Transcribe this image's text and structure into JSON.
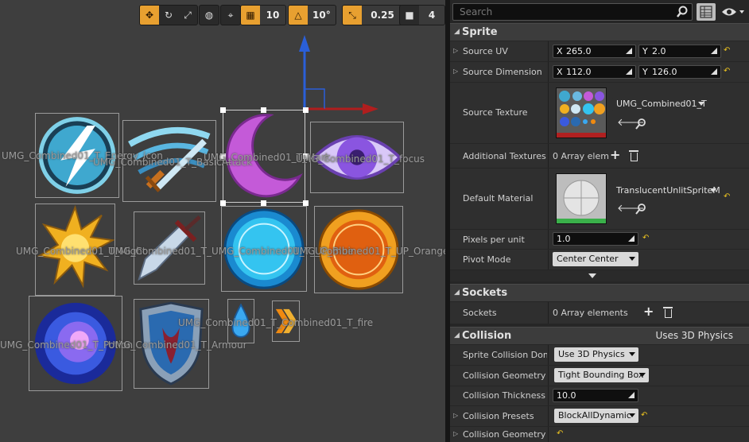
{
  "toolbar": {
    "grid_snap_value": "10",
    "rotation_snap_value": "10°",
    "scale_snap_value": "0.25",
    "camera_speed_value": "4"
  },
  "sprites": [
    {
      "label": "UMG_Combined01_T_Energy_icon"
    },
    {
      "label": "UMG_Combined01_T_BasicAttack"
    },
    {
      "label": "UMG_Combined01_T_Mark"
    },
    {
      "label": "UMG_Combined01_T_focus"
    },
    {
      "label": "UMG_Combined01_T_Might"
    },
    {
      "label": "UMG_Combined01_T_UMG_Combined01_T_UP_Blue"
    },
    {
      "label": "UMG_Combined01_T_UP_Orange"
    },
    {
      "label": "UMG_Combined01_T_Potion"
    },
    {
      "label": "UMG_Combined01_T_Armour"
    },
    {
      "label": "UMG_Combined01_T_Combined01_T_fire"
    }
  ],
  "search": {
    "placeholder": "Search"
  },
  "sprite_category": {
    "title": "Sprite",
    "source_uv": {
      "label": "Source UV",
      "x": "265.0",
      "y": "2.0"
    },
    "source_dimension": {
      "label": "Source Dimension",
      "x": "112.0",
      "y": "126.0"
    },
    "source_texture": {
      "label": "Source Texture",
      "value": "UMG_Combined01_T"
    },
    "additional_textures": {
      "label": "Additional Textures",
      "value": "0 Array elem"
    },
    "default_material": {
      "label": "Default Material",
      "value": "TranslucentUnlitSpriteM"
    },
    "pixels_per_unit": {
      "label": "Pixels per unit",
      "value": "1.0"
    },
    "pivot_mode": {
      "label": "Pivot Mode",
      "value": "Center Center"
    }
  },
  "sockets_category": {
    "title": "Sockets",
    "sockets": {
      "label": "Sockets",
      "value": "0 Array elements"
    }
  },
  "collision_category": {
    "title": "Collision",
    "extra": "Uses 3D Physics",
    "sprite_collision_domain": {
      "label": "Sprite Collision Doma",
      "value": "Use 3D Physics"
    },
    "collision_geometry_type": {
      "label": "Collision Geometry Ty",
      "value": "Tight Bounding Box"
    },
    "collision_thickness": {
      "label": "Collision Thickness",
      "value": "10.0"
    },
    "collision_presets": {
      "label": "Collision Presets",
      "value": "BlockAllDynamic"
    },
    "collision_geometry": {
      "label": "Collision Geometry"
    }
  },
  "axis_labels": {
    "x": "X",
    "y": "Y"
  }
}
